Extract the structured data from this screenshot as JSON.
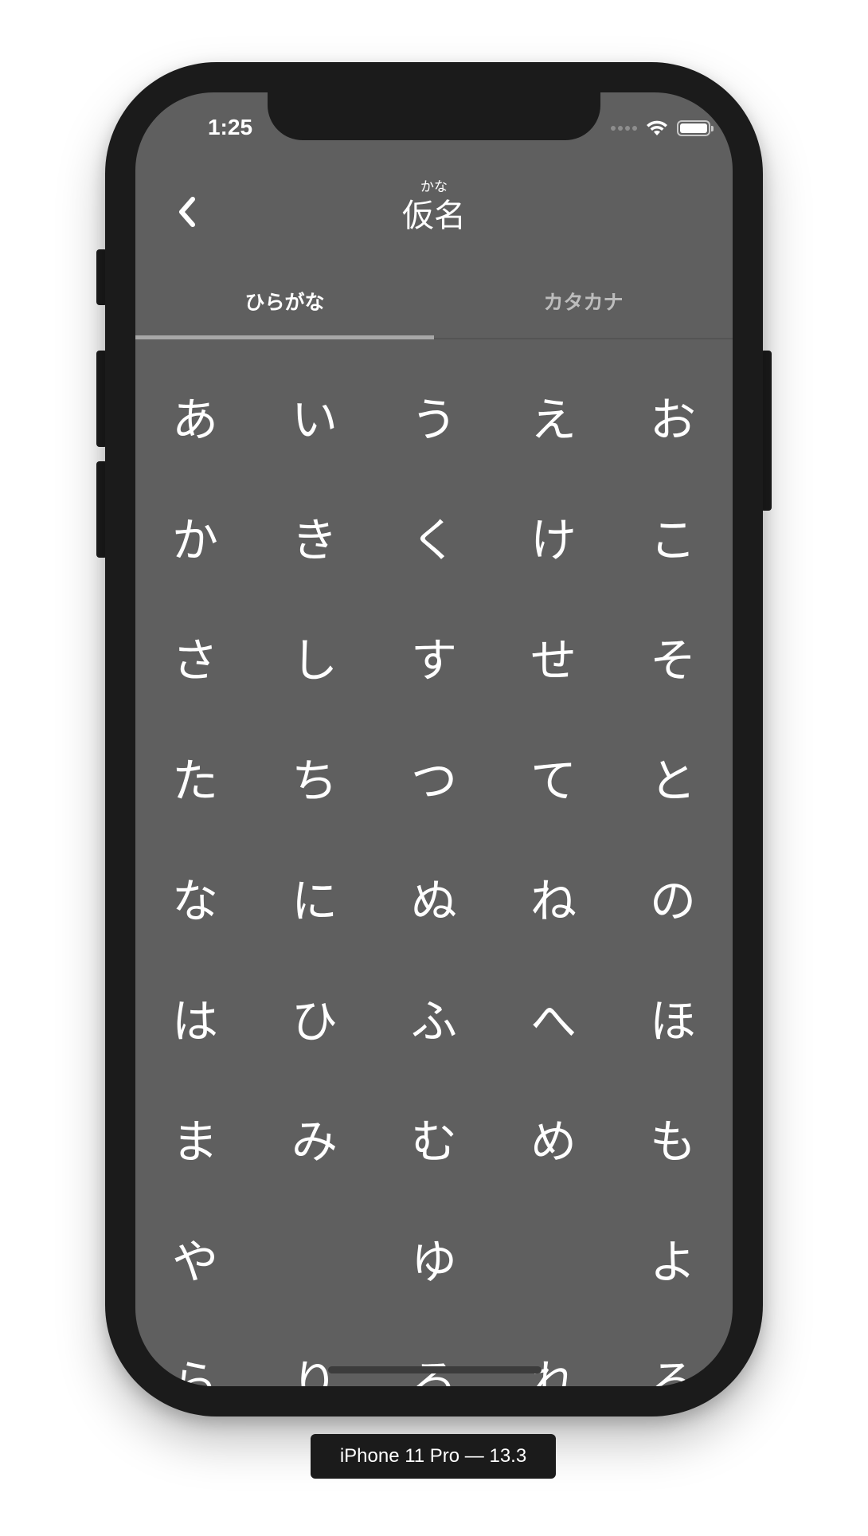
{
  "status_bar": {
    "time": "1:25",
    "icons": [
      "cellular-signal-icon",
      "wifi-icon",
      "battery-icon"
    ]
  },
  "nav": {
    "back_icon": "chevron-left-icon",
    "title_ruby": "かな",
    "title": "仮名"
  },
  "tabs": [
    {
      "label": "ひらがな",
      "active": true
    },
    {
      "label": "カタカナ",
      "active": false
    }
  ],
  "kana_rows": [
    [
      "あ",
      "い",
      "う",
      "え",
      "お"
    ],
    [
      "か",
      "き",
      "く",
      "け",
      "こ"
    ],
    [
      "さ",
      "し",
      "す",
      "せ",
      "そ"
    ],
    [
      "た",
      "ち",
      "つ",
      "て",
      "と"
    ],
    [
      "な",
      "に",
      "ぬ",
      "ね",
      "の"
    ],
    [
      "は",
      "ひ",
      "ふ",
      "へ",
      "ほ"
    ],
    [
      "ま",
      "み",
      "む",
      "め",
      "も"
    ],
    [
      "や",
      "",
      "ゆ",
      "",
      "よ"
    ],
    [
      "ら",
      "り",
      "る",
      "れ",
      "ろ"
    ]
  ],
  "device_label": "iPhone 11 Pro — 13.3",
  "colors": {
    "screen_background": "#5f5f5f",
    "device_frame": "#1b1b1b",
    "text": "#ffffff",
    "inactive_tab_text": "#bdbdbd",
    "tab_indicator": "#a8a8a8"
  }
}
